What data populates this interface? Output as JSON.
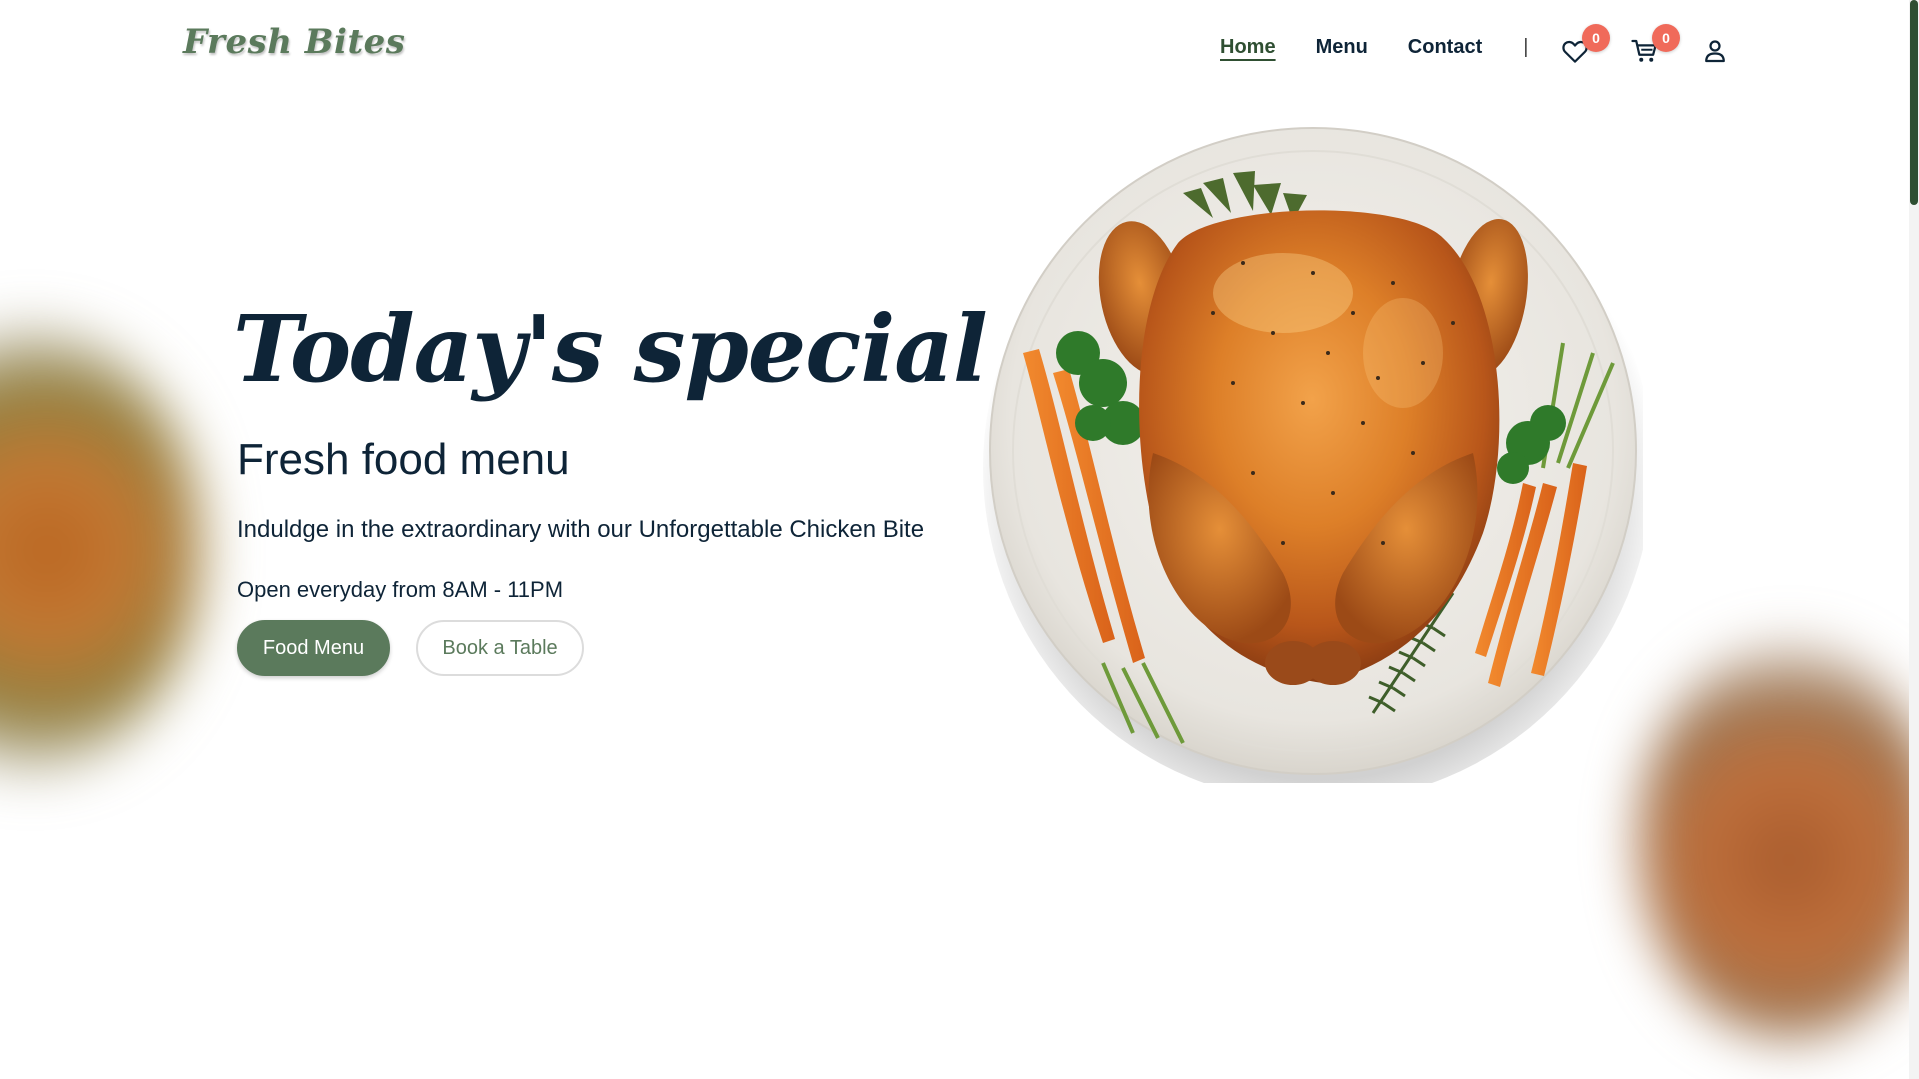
{
  "header": {
    "logo_text": "Fresh Bites",
    "nav": [
      {
        "label": "Home",
        "active": true
      },
      {
        "label": "Menu",
        "active": false
      },
      {
        "label": "Contact",
        "active": false
      }
    ],
    "separator": "|",
    "wishlist_count": "0",
    "cart_count": "0",
    "icons": [
      "heart-icon",
      "cart-icon",
      "user-icon"
    ]
  },
  "hero": {
    "title": "Today's special",
    "subtitle": "Fresh food menu",
    "description": "Induldge in the extraordinary with our Unforgettable Chicken Bite",
    "hours": "Open everyday from 8AM - 11PM",
    "primary_button": "Food Menu",
    "secondary_button": "Book a Table"
  },
  "colors": {
    "brand_green": "#5b7a5c",
    "dark_green": "#2f4f32",
    "text_navy": "#0e2437",
    "badge_red": "#f06a5a"
  }
}
